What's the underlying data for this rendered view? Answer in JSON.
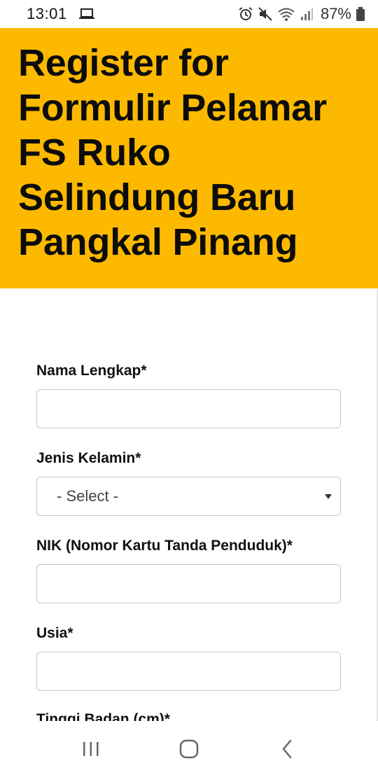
{
  "status_bar": {
    "time": "13:01",
    "battery": "87%",
    "icons": [
      "laptop-icon",
      "alarm-icon",
      "mute-icon",
      "wifi-icon",
      "signal-icon",
      "battery-icon"
    ]
  },
  "header": {
    "title_lines": [
      "Register for",
      "Formulir Pelamar",
      "FS Ruko",
      "Selindung Baru",
      "Pangkal Pinang"
    ],
    "background": "#fdb900"
  },
  "form": {
    "fields": [
      {
        "label": "Nama Lengkap*",
        "type": "text",
        "value": ""
      },
      {
        "label": "Jenis Kelamin*",
        "type": "select",
        "selected": "- Select -"
      },
      {
        "label": "NIK (Nomor Kartu Tanda Penduduk)*",
        "type": "text",
        "value": ""
      },
      {
        "label": "Usia*",
        "type": "text",
        "value": ""
      },
      {
        "label": "Tinggi Badan (cm)*",
        "type": "text",
        "value": ""
      }
    ]
  },
  "nav_bar": {
    "icons": [
      "recent-apps-icon",
      "home-icon",
      "back-icon"
    ]
  }
}
